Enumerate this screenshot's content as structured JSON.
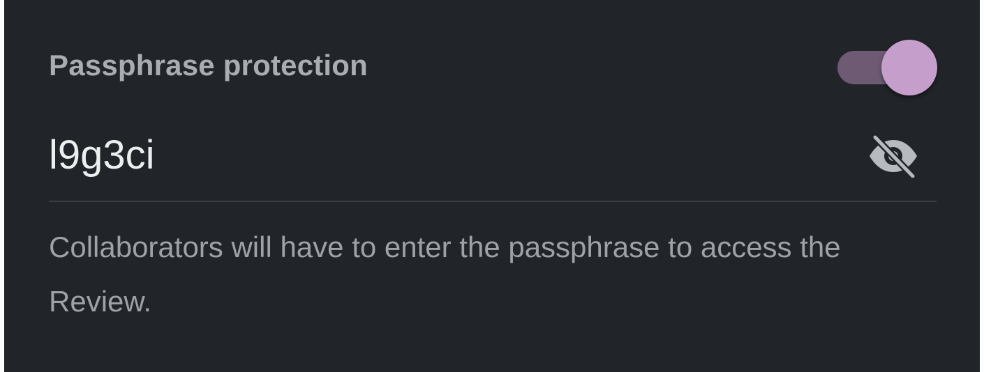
{
  "passphrase_protection": {
    "title": "Passphrase protection",
    "enabled": true,
    "passphrase_value": "l9g3ci",
    "visibility_icon": "eye-off-icon",
    "helper_text": "Collaborators will have to enter the passphrase to access the Review."
  },
  "colors": {
    "background": "#212428",
    "toggle_track": "#6e5b73",
    "toggle_thumb": "#c69ecb",
    "title_text": "#a9adb1",
    "value_text": "#eceef0",
    "helper_text": "#9ea2a7",
    "divider": "#3b3f44"
  }
}
